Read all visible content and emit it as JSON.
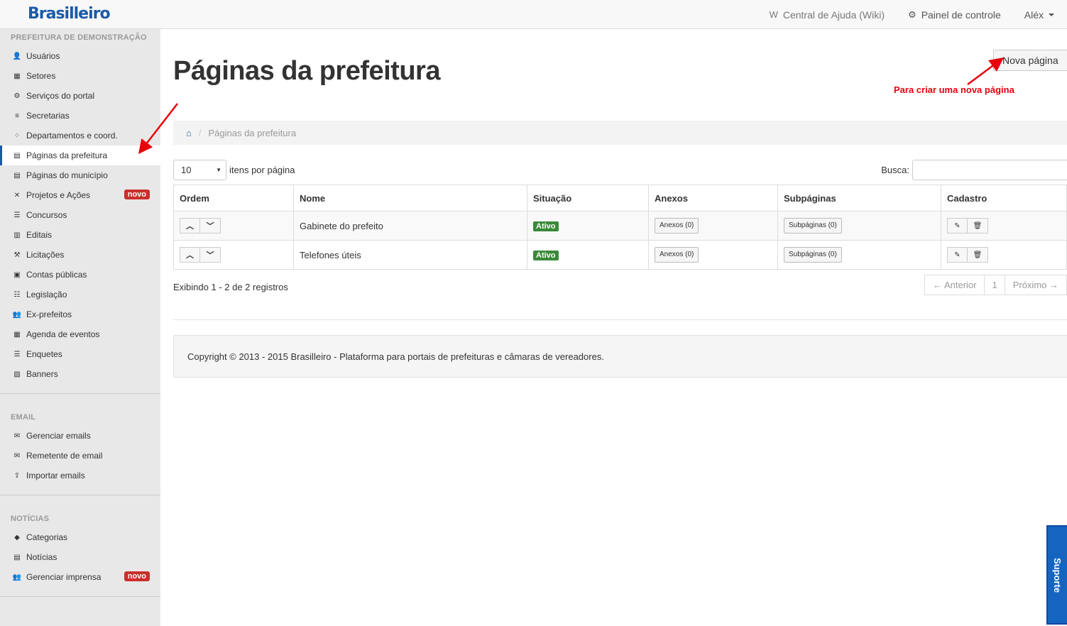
{
  "topbar": {
    "brand": "Brasilleiro",
    "wiki": "Central de Ajuda (Wiki)",
    "wiki_icon": "W",
    "panel": "Painel de controle",
    "user": "Aléx"
  },
  "sidebar": {
    "section1": {
      "title": "PREFEITURA DE DEMONSTRAÇÃO",
      "items": [
        {
          "label": "Usuários",
          "icon": "user-icon",
          "glyph": "👤"
        },
        {
          "label": "Setores",
          "icon": "grid-icon",
          "glyph": "▦"
        },
        {
          "label": "Serviços do portal",
          "icon": "cogs-icon",
          "glyph": "⚙"
        },
        {
          "label": "Secretarias",
          "icon": "list-icon",
          "glyph": "≡"
        },
        {
          "label": "Departamentos e coord.",
          "icon": "dots-icon",
          "glyph": "⁘"
        },
        {
          "label": "Páginas da prefeitura",
          "icon": "newspaper-icon",
          "glyph": "▤",
          "active": true
        },
        {
          "label": "Páginas do município",
          "icon": "newspaper-icon",
          "glyph": "▤"
        },
        {
          "label": "Projetos e Ações",
          "icon": "tools-icon",
          "glyph": "✕",
          "badge": "novo"
        },
        {
          "label": "Concursos",
          "icon": "list-alt-icon",
          "glyph": "☰"
        },
        {
          "label": "Editais",
          "icon": "file-icon",
          "glyph": "▥"
        },
        {
          "label": "Licitações",
          "icon": "gavel-icon",
          "glyph": "⚒"
        },
        {
          "label": "Contas públicas",
          "icon": "money-icon",
          "glyph": "▣"
        },
        {
          "label": "Legislação",
          "icon": "ordered-list-icon",
          "glyph": "☷"
        },
        {
          "label": "Ex-prefeitos",
          "icon": "users-icon",
          "glyph": "👥"
        },
        {
          "label": "Agenda de eventos",
          "icon": "calendar-icon",
          "glyph": "▦"
        },
        {
          "label": "Enquetes",
          "icon": "list-alt-icon",
          "glyph": "☰"
        },
        {
          "label": "Banners",
          "icon": "image-icon",
          "glyph": "▨"
        }
      ]
    },
    "section2": {
      "title": "EMAIL",
      "items": [
        {
          "label": "Gerenciar emails",
          "icon": "envelope-outline-icon",
          "glyph": "✉"
        },
        {
          "label": "Remetente de email",
          "icon": "envelope-icon",
          "glyph": "✉"
        },
        {
          "label": "Importar emails",
          "icon": "upload-icon",
          "glyph": "⇪"
        }
      ]
    },
    "section3": {
      "title": "NOTÍCIAS",
      "items": [
        {
          "label": "Categorias",
          "icon": "tag-icon",
          "glyph": "◆"
        },
        {
          "label": "Notícias",
          "icon": "newspaper-icon",
          "glyph": "▤"
        },
        {
          "label": "Gerenciar imprensa",
          "icon": "users-icon",
          "glyph": "👥",
          "badge": "novo"
        }
      ]
    }
  },
  "main": {
    "title": "Páginas da prefeitura",
    "new_button": "Nova página",
    "annotation": "Para criar uma nova página",
    "breadcrumb": "Páginas da prefeitura",
    "per_page_value": "10",
    "per_page_label": "itens por página",
    "search_label": "Busca:",
    "table": {
      "headers": [
        "Ordem",
        "Nome",
        "Situação",
        "Anexos",
        "Subpáginas",
        "Cadastro"
      ],
      "rows": [
        {
          "name": "Gabinete do prefeito",
          "status": "Ativo",
          "attachments": "Anexos (0)",
          "subpages": "Subpáginas (0)"
        },
        {
          "name": "Telefones úteis",
          "status": "Ativo",
          "attachments": "Anexos (0)",
          "subpages": "Subpáginas (0)"
        }
      ]
    },
    "info": "Exibindo 1 - 2 de 2 registros",
    "pager": {
      "prev": "← Anterior",
      "page": "1",
      "next": "Próximo →"
    },
    "footer": "Copyright © 2013 - 2015 Brasilleiro - Plataforma para portais de prefeituras e câmaras de vereadores."
  },
  "support": "Suporte",
  "colors": {
    "brand": "#1c5aa6",
    "badge": "#c9302c",
    "status": "#3a8a3a",
    "annotation": "#e8000b"
  }
}
